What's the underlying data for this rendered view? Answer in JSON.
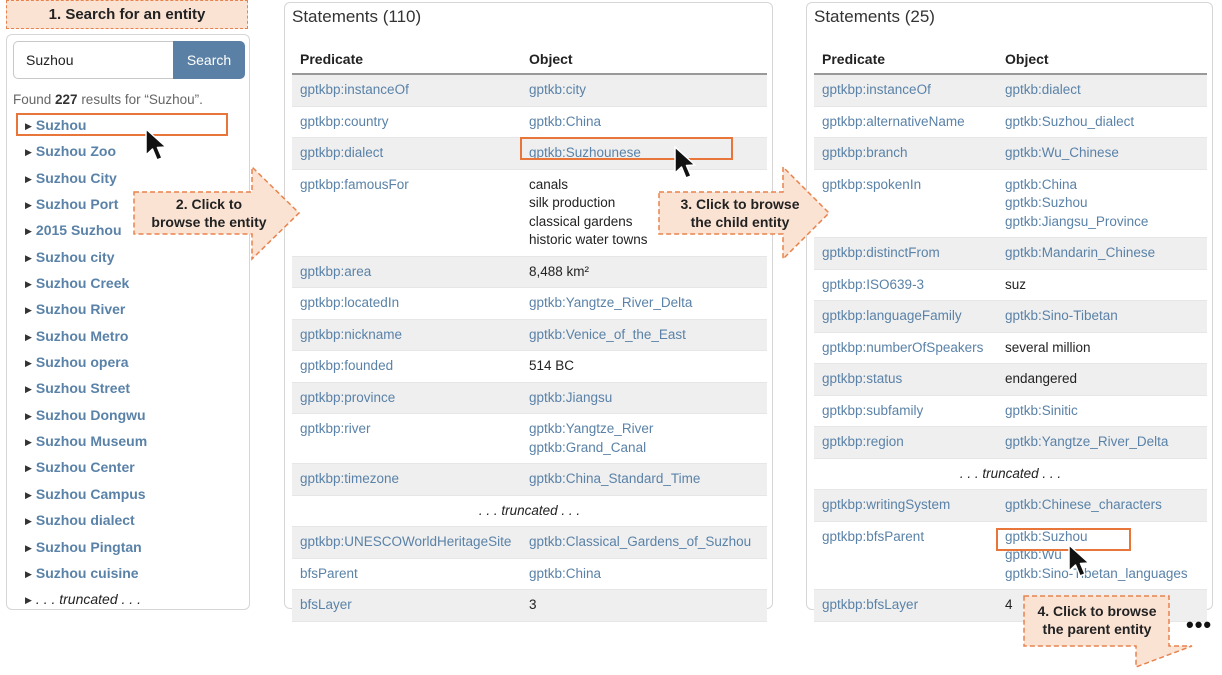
{
  "step1": "1. Search for an entity",
  "step2": [
    "2. Click to",
    "browse the entity"
  ],
  "step3": [
    "3. Click to browse",
    "the child entity"
  ],
  "step4": [
    "4. Click to browse",
    "the parent entity"
  ],
  "colors": {
    "accent": "#5b80a5",
    "link": "#5a82a8",
    "callout_fill": "#fbe3d4",
    "callout_border": "#e8834e",
    "highlight": "#e8753a"
  },
  "search": {
    "value": "Suzhou",
    "button": "Search",
    "found_prefix": "Found ",
    "found_count": "227",
    "found_suffix": " results for “Suzhou”.",
    "results": [
      "Suzhou",
      "Suzhou Zoo",
      "Suzhou City",
      "Suzhou Port",
      "2015 Suzhou",
      "Suzhou city",
      "Suzhou Creek",
      "Suzhou River",
      "Suzhou Metro",
      "Suzhou opera",
      "Suzhou Street",
      "Suzhou Dongwu",
      "Suzhou Museum",
      "Suzhou Center",
      "Suzhou Campus",
      "Suzhou dialect",
      "Suzhou Pingtan",
      "Suzhou cuisine"
    ],
    "truncated": ". . . truncated . . ."
  },
  "middle": {
    "title": "Statements (110)",
    "col_predicate": "Predicate",
    "col_object": "Object",
    "rows": [
      {
        "p": "gptkbp:instanceOf",
        "o": [
          "gptkb:city"
        ],
        "link": true
      },
      {
        "p": "gptkbp:country",
        "o": [
          "gptkb:China"
        ],
        "link": true
      },
      {
        "p": "gptkbp:dialect",
        "o": [
          "gptkb:Suzhounese"
        ],
        "link": true
      },
      {
        "p": "gptkbp:famousFor",
        "o": [
          "canals",
          "silk production",
          "classical gardens",
          "historic water towns"
        ],
        "link": false
      },
      {
        "p": "gptkbp:area",
        "o": [
          "8,488 km²"
        ],
        "link": false
      },
      {
        "p": "gptkbp:locatedIn",
        "o": [
          "gptkb:Yangtze_River_Delta"
        ],
        "link": true
      },
      {
        "p": "gptkbp:nickname",
        "o": [
          "gptkb:Venice_of_the_East"
        ],
        "link": true
      },
      {
        "p": "gptkbp:founded",
        "o": [
          "514 BC"
        ],
        "link": false
      },
      {
        "p": "gptkbp:province",
        "o": [
          "gptkb:Jiangsu"
        ],
        "link": true
      },
      {
        "p": "gptkbp:river",
        "o": [
          "gptkb:Yangtze_River",
          "gptkb:Grand_Canal"
        ],
        "link": true
      },
      {
        "p": "gptkbp:timezone",
        "o": [
          "gptkb:China_Standard_Time"
        ],
        "link": true
      },
      {
        "trunc": ". . . truncated . . ."
      },
      {
        "p": "gptkbp:UNESCOWorldHeritageSite",
        "o": [
          "gptkb:Classical_Gardens_of_Suzhou"
        ],
        "link": true
      },
      {
        "p": "bfsParent",
        "o": [
          "gptkb:China"
        ],
        "link": true
      },
      {
        "p": "bfsLayer",
        "o": [
          "3"
        ],
        "link": false
      }
    ]
  },
  "right": {
    "title": "Statements (25)",
    "col_predicate": "Predicate",
    "col_object": "Object",
    "rows": [
      {
        "p": "gptkbp:instanceOf",
        "o": [
          "gptkb:dialect"
        ],
        "link": true
      },
      {
        "p": "gptkbp:alternativeName",
        "o": [
          "gptkb:Suzhou_dialect"
        ],
        "link": true
      },
      {
        "p": "gptkbp:branch",
        "o": [
          "gptkb:Wu_Chinese"
        ],
        "link": true
      },
      {
        "p": "gptkbp:spokenIn",
        "o": [
          "gptkb:China",
          "gptkb:Suzhou",
          "gptkb:Jiangsu_Province"
        ],
        "link": true
      },
      {
        "p": "gptkbp:distinctFrom",
        "o": [
          "gptkb:Mandarin_Chinese"
        ],
        "link": true
      },
      {
        "p": "gptkbp:ISO639-3",
        "o": [
          "suz"
        ],
        "link": false
      },
      {
        "p": "gptkbp:languageFamily",
        "o": [
          "gptkb:Sino-Tibetan"
        ],
        "link": true
      },
      {
        "p": "gptkbp:numberOfSpeakers",
        "o": [
          "several million"
        ],
        "link": false
      },
      {
        "p": "gptkbp:status",
        "o": [
          "endangered"
        ],
        "link": false
      },
      {
        "p": "gptkbp:subfamily",
        "o": [
          "gptkb:Sinitic"
        ],
        "link": true
      },
      {
        "p": "gptkbp:region",
        "o": [
          "gptkb:Yangtze_River_Delta"
        ],
        "link": true
      },
      {
        "trunc": ". . . truncated . . ."
      },
      {
        "p": "gptkbp:writingSystem",
        "o": [
          "gptkb:Chinese_characters"
        ],
        "link": true
      },
      {
        "p": "gptkbp:bfsParent",
        "o": [
          "gptkb:Suzhou",
          "gptkb:Wu",
          "gptkb:Sino-Tibetan_languages"
        ],
        "link": true
      },
      {
        "p": "gptkbp:bfsLayer",
        "o": [
          "4"
        ],
        "link": false
      }
    ]
  },
  "more": "•••"
}
